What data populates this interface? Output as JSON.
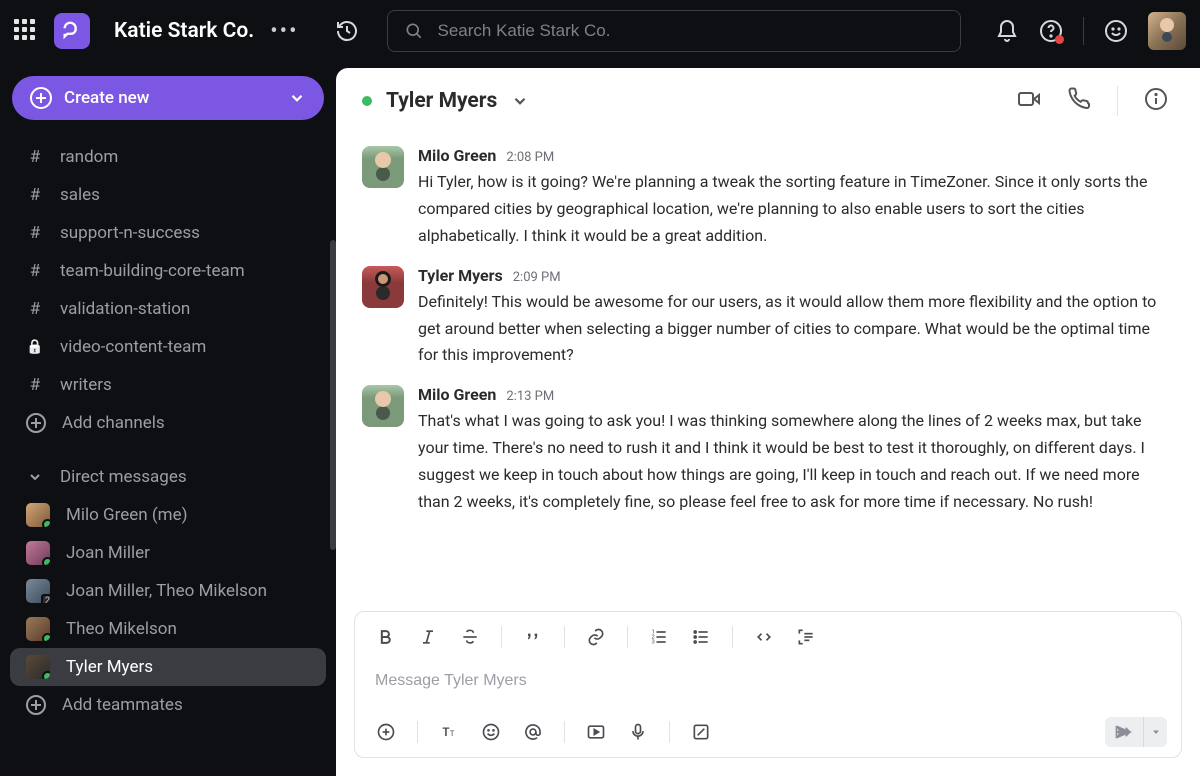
{
  "workspace": {
    "name": "Katie Stark Co."
  },
  "search": {
    "placeholder": "Search Katie Stark Co."
  },
  "sidebar": {
    "create_label": "Create new",
    "channels": [
      {
        "name": "random",
        "icon": "hash"
      },
      {
        "name": "sales",
        "icon": "hash"
      },
      {
        "name": "support-n-success",
        "icon": "hash"
      },
      {
        "name": "team-building-core-team",
        "icon": "hash"
      },
      {
        "name": "validation-station",
        "icon": "hash"
      },
      {
        "name": "video-content-team",
        "icon": "lock"
      },
      {
        "name": "writers",
        "icon": "hash"
      }
    ],
    "add_channels_label": "Add channels",
    "dm_section_label": "Direct messages",
    "dms": [
      {
        "name": "Milo Green (me)",
        "presence": "online"
      },
      {
        "name": "Joan Miller",
        "presence": "online"
      },
      {
        "name": "Joan Miller, Theo Mikelson",
        "presence": "badge",
        "badge": "2"
      },
      {
        "name": "Theo Mikelson",
        "presence": "online"
      },
      {
        "name": "Tyler Myers",
        "presence": "online",
        "active": true
      }
    ],
    "add_teammates_label": "Add teammates"
  },
  "chat": {
    "title": "Tyler Myers",
    "messages": [
      {
        "author": "Milo Green",
        "time": "2:08 PM",
        "avatar": "milo",
        "text": "Hi Tyler, how is it going? We're planning a tweak the sorting feature in TimeZoner. Since it only sorts the compared cities by geographical location, we're planning to also enable users to sort the cities alphabetically. I think it would be a great addition."
      },
      {
        "author": "Tyler Myers",
        "time": "2:09 PM",
        "avatar": "tyler",
        "text": "Definitely! This would be awesome for our users, as it would allow them more flexibility and the option to get around better when selecting a bigger number of cities to compare. What would be the optimal time for this improvement?"
      },
      {
        "author": "Milo Green",
        "time": "2:13 PM",
        "avatar": "milo",
        "text": "That's what I was going to ask you! I was thinking somewhere along the lines of 2 weeks max, but take your time. There's no need to rush it and I think it would be best to test it thoroughly, on different days. I suggest we keep in touch about how things are going, I'll keep in touch and reach out. If we need more than 2 weeks, it's completely fine, so please feel free to ask for more time if necessary. No rush!"
      }
    ]
  },
  "composer": {
    "placeholder": "Message Tyler Myers"
  }
}
